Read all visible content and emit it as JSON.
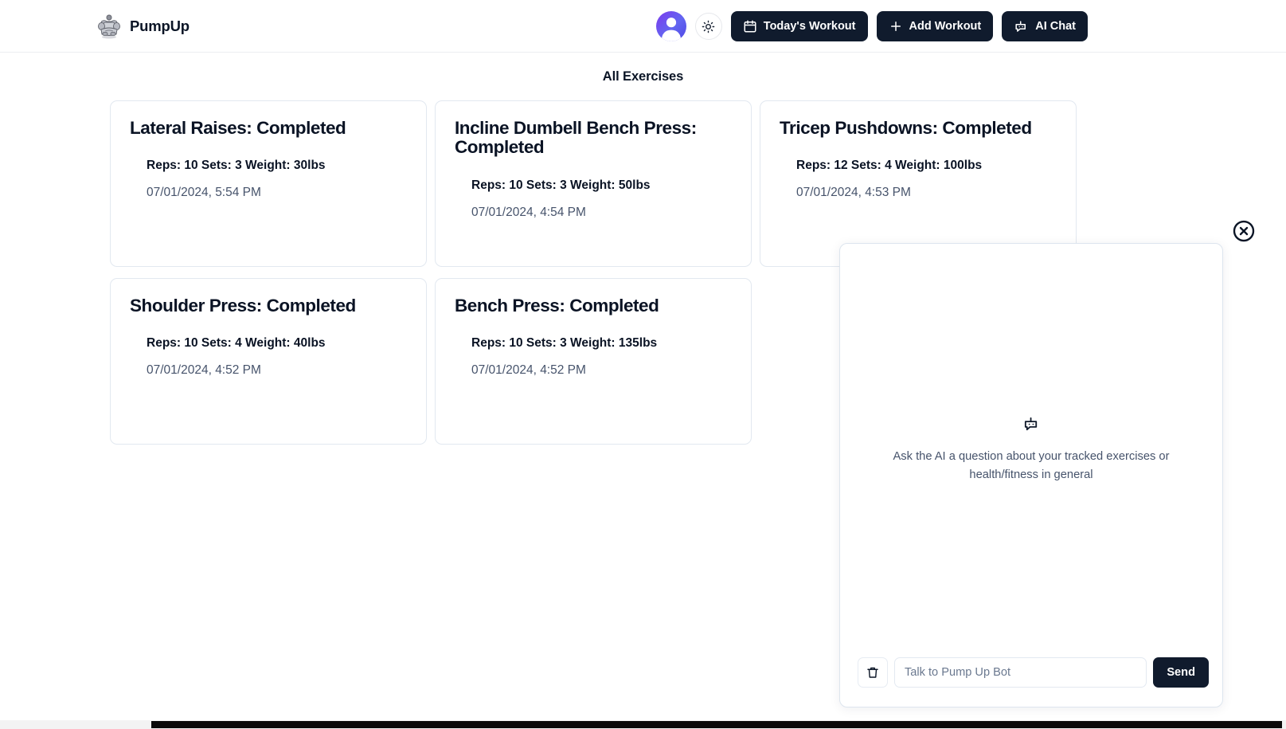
{
  "header": {
    "brand_name": "PumpUp",
    "logo_icon": "muscle-man-logo",
    "avatar_icon": "user-avatar",
    "theme_toggle_icon": "sun-icon",
    "buttons": [
      {
        "label": "Today's Workout",
        "icon": "calendar-icon"
      },
      {
        "label": "Add Workout",
        "icon": "plus-icon"
      },
      {
        "label": "AI Chat",
        "icon": "bot-icon"
      }
    ],
    "accent_dark": "#101b2d",
    "avatar_gradient_from": "#7c3aed",
    "avatar_gradient_to": "#4f46e5"
  },
  "main": {
    "page_title": "All Exercises",
    "cards": [
      {
        "title": "Lateral Raises: Completed",
        "stats": "Reps: 10 Sets: 3 Weight: 30lbs",
        "timestamp": "07/01/2024, 5:54 PM"
      },
      {
        "title": "Incline Dumbell Bench Press: Completed",
        "stats": "Reps: 10 Sets: 3 Weight: 50lbs",
        "timestamp": "07/01/2024, 4:54 PM"
      },
      {
        "title": "Tricep Pushdowns: Completed",
        "stats": "Reps: 12 Sets: 4 Weight: 100lbs",
        "timestamp": "07/01/2024, 4:53 PM"
      },
      {
        "title": "Shoulder Press: Completed",
        "stats": "Reps: 10 Sets: 4 Weight: 40lbs",
        "timestamp": "07/01/2024, 4:52 PM"
      },
      {
        "title": "Bench Press: Completed",
        "stats": "Reps: 10 Sets: 3 Weight: 135lbs",
        "timestamp": "07/01/2024, 4:52 PM"
      }
    ]
  },
  "chat": {
    "close_icon": "circle-x-icon",
    "empty_icon": "bot-icon",
    "empty_text": "Ask the AI a question about your tracked exercises or health/fitness in general",
    "clear_icon": "trash-icon",
    "input_value": "",
    "input_placeholder": "Talk to Pump Up Bot",
    "send_label": "Send"
  }
}
